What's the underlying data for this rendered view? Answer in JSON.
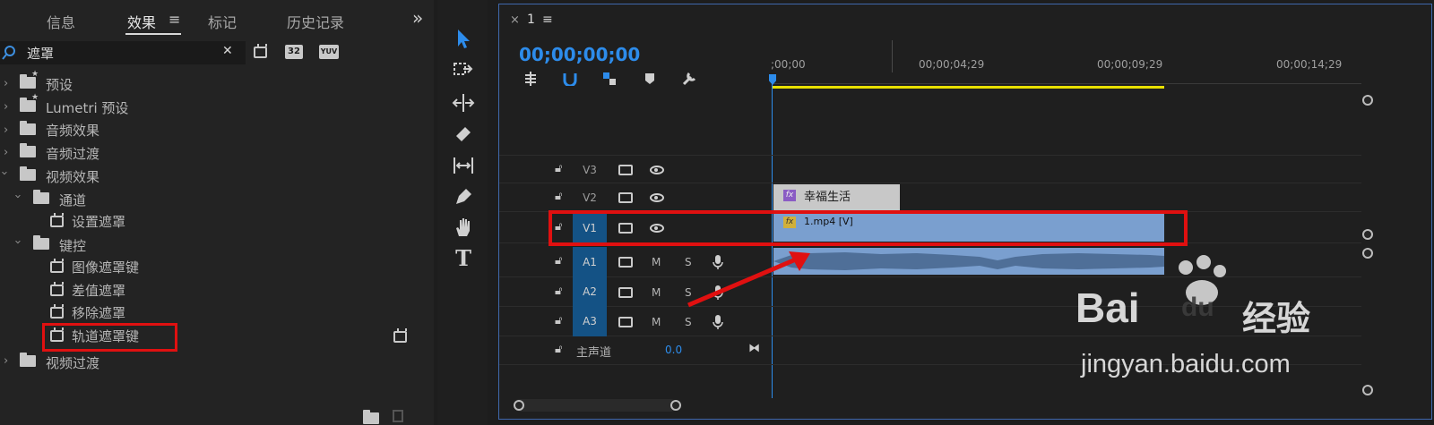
{
  "effects_panel": {
    "tabs": [
      "信息",
      "效果",
      "标记",
      "历史记录"
    ],
    "menu_glyph": "≡",
    "overflow_glyph": "»",
    "search_value": "遮罩",
    "clear_glyph": "✕",
    "badges": [
      "32",
      "YUV"
    ],
    "tree": {
      "presets": "预设",
      "lumetri": "Lumetri 预设",
      "audio_effects": "音频效果",
      "audio_transitions": "音频过渡",
      "video_effects": "视频效果",
      "channel": "通道",
      "set_matte": "设置遮罩",
      "keying": "键控",
      "image_matte_key": "图像遮罩键",
      "difference_matte": "差值遮罩",
      "remove_matte": "移除遮罩",
      "track_matte_key": "轨道遮罩键",
      "video_transitions": "视频过渡"
    }
  },
  "timeline": {
    "sequence_name": "1",
    "close_glyph": "×",
    "menu_glyph": "≡",
    "timecode": "00;00;00;00",
    "ruler": [
      ";00;00",
      "00;00;04;29",
      "00;00;09;29",
      "00;00;14;29"
    ],
    "tracks": {
      "v3": "V3",
      "v2": "V2",
      "v1": "V1",
      "a1": "A1",
      "a2": "A2",
      "a3": "A3",
      "m": "M",
      "s": "S"
    },
    "master": {
      "label": "主声道",
      "value": "0.0"
    },
    "clips": {
      "v2_title": "幸福生活",
      "v1_title": "1.mp4 [V]",
      "fx": "fx"
    }
  },
  "watermark": {
    "brand_a": "Bai",
    "brand_b": "du",
    "brand_c": "经验",
    "url": "jingyan.baidu.com"
  },
  "colors": {
    "accent_blue": "#2d8ceb",
    "highlight_red": "#e01010",
    "clip_blue": "#7a9fcf",
    "clip_gray": "#c8c8c8",
    "work_area_yellow": "#e8e000"
  }
}
